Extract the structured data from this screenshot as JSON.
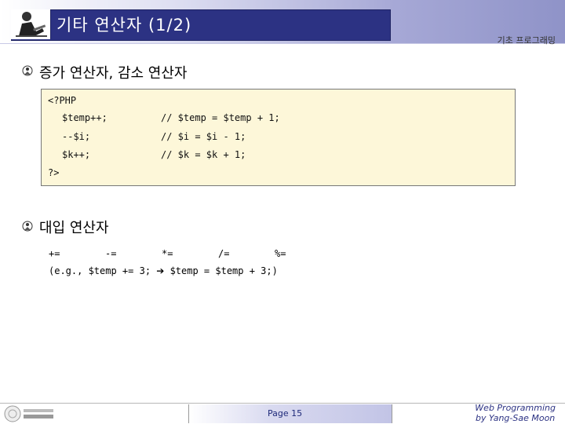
{
  "header": {
    "title": "기타 연산자 (1/2)",
    "course": "기초 프로그래밍"
  },
  "section1": {
    "heading": "증가 연산자, 감소 연산자",
    "code": {
      "open_tag": "<?PHP",
      "lines": [
        {
          "stmt": "$temp++;",
          "comment": "// $temp = $temp + 1;"
        },
        {
          "stmt": "--$i;",
          "comment": "// $i = $i - 1;"
        },
        {
          "stmt": "$k++;",
          "comment": "// $k = $k + 1;"
        }
      ],
      "close_tag": "?>"
    }
  },
  "section2": {
    "heading": "대입 연산자",
    "operators": [
      "+=",
      "-=",
      "*=",
      "/=",
      "%="
    ],
    "example_prefix": "(e.g., $temp += 3; ",
    "example_arrow": "➔",
    "example_suffix": " $temp = $temp + 3;)"
  },
  "footer": {
    "page": "Page 15",
    "credit_line1": "Web Programming",
    "credit_line2": "by Yang-Sae Moon"
  },
  "colors": {
    "title_bg": "#2c3283",
    "code_bg": "#fdf7d9",
    "footer_text": "#2c3283"
  }
}
